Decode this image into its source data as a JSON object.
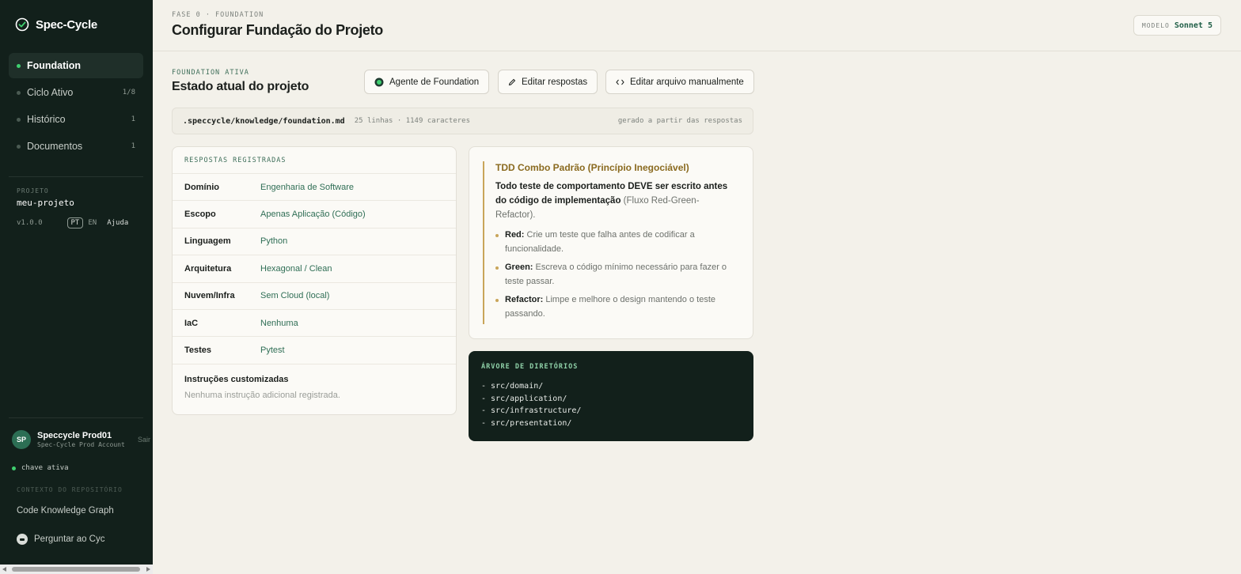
{
  "sidebar": {
    "brand": "Spec-Cycle",
    "nav": [
      {
        "label": "Foundation",
        "count": ""
      },
      {
        "label": "Ciclo Ativo",
        "count": "1/8"
      },
      {
        "label": "Histórico",
        "count": "1"
      },
      {
        "label": "Documentos",
        "count": "1"
      }
    ],
    "project_label": "PROJETO",
    "project_name": "meu-projeto",
    "version": "v1.0.0",
    "lang_pt": "PT",
    "lang_en": "EN",
    "help": "Ajuda",
    "user": {
      "initials": "SP",
      "name": "Speccycle Prod01",
      "account": "Spec-Cycle Prod Account",
      "logout": "Sair"
    },
    "key_status": "chave ativa",
    "context_label": "CONTEXTO DO REPOSITÓRIO",
    "ckg": "Code Knowledge Graph",
    "ask": "Perguntar ao Cyc"
  },
  "header": {
    "phase": "FASE 0 · FOUNDATION",
    "title": "Configurar Fundação do Projeto",
    "model_label": "MODELO",
    "model_value": "Sonnet 5"
  },
  "section": {
    "active_label": "FOUNDATION ATIVA",
    "title": "Estado atual do projeto",
    "buttons": {
      "agent": "Agente de Foundation",
      "edit_answers": "Editar respostas",
      "edit_file": "Editar arquivo manualmente"
    }
  },
  "file": {
    "path": ".speccycle/knowledge/foundation.md",
    "meta": "25 linhas · 1149 caracteres",
    "generated": "gerado a partir das respostas"
  },
  "answers": {
    "title": "RESPOSTAS REGISTRADAS",
    "rows": [
      {
        "key": "Domínio",
        "value": "Engenharia de Software"
      },
      {
        "key": "Escopo",
        "value": "Apenas Aplicação (Código)"
      },
      {
        "key": "Linguagem",
        "value": "Python"
      },
      {
        "key": "Arquitetura",
        "value": "Hexagonal / Clean"
      },
      {
        "key": "Nuvem/Infra",
        "value": "Sem Cloud (local)"
      },
      {
        "key": "IaC",
        "value": "Nenhuma"
      },
      {
        "key": "Testes",
        "value": "Pytest"
      }
    ],
    "custom_title": "Instruções customizadas",
    "custom_desc": "Nenhuma instrução adicional registrada."
  },
  "principle": {
    "title": "TDD Combo Padrão (Princípio Inegociável)",
    "body_bold": "Todo teste de comportamento DEVE ser escrito antes do código de implementação",
    "body_rest": " (Fluxo Red-Green-Refactor).",
    "bullets": [
      {
        "term": "Red:",
        "text": " Crie um teste que falha antes de codificar a funcionalidade."
      },
      {
        "term": "Green:",
        "text": " Escreva o código mínimo necessário para fazer o teste passar."
      },
      {
        "term": "Refactor:",
        "text": " Limpe e melhore o design mantendo o teste passando."
      }
    ]
  },
  "tree": {
    "title": "ÁRVORE DE DIRETÓRIOS",
    "items": [
      "- src/domain/",
      "- src/application/",
      "- src/infrastructure/",
      "- src/presentation/"
    ]
  },
  "colors": {
    "sidebar_bg": "#12201b",
    "accent_green": "#3fcf6f",
    "link_green": "#2f6e55",
    "gold": "#c9a55a"
  }
}
